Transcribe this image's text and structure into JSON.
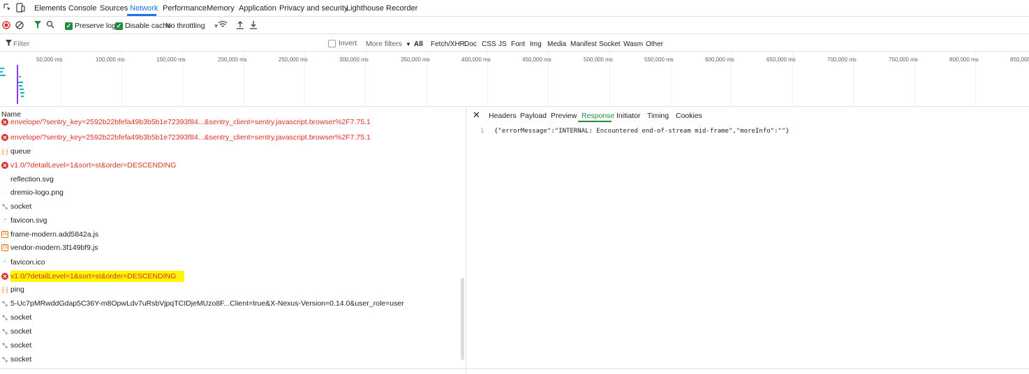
{
  "tabs": {
    "inspect_icon": "inspect-cursor-icon",
    "device_icon": "device-toggle-icon",
    "items": [
      "Elements",
      "Console",
      "Sources",
      "Network",
      "Performance",
      "Memory",
      "Application",
      "Privacy and security",
      "Lighthouse",
      "Recorder"
    ],
    "active": "Network"
  },
  "toolbar": {
    "preserve_log": "Preserve log",
    "disable_cache": "Disable cache",
    "throttling": "No throttling"
  },
  "filter": {
    "placeholder": "Filter",
    "invert": "Invert",
    "more_filters": "More filters",
    "types": [
      "All",
      "Fetch/XHR",
      "Doc",
      "CSS",
      "JS",
      "Font",
      "Img",
      "Media",
      "Manifest",
      "Socket",
      "Wasm",
      "Other"
    ]
  },
  "timeline": {
    "ticks": [
      "50,000 ms",
      "100,000 ms",
      "150,000 ms",
      "200,000 ms",
      "250,000 ms",
      "300,000 ms",
      "350,000 ms",
      "400,000 ms",
      "450,000 ms",
      "500,000 ms",
      "550,000 ms",
      "600,000 ms",
      "650,000 ms",
      "700,000 ms",
      "750,000 ms",
      "800,000 ms",
      "850,000"
    ]
  },
  "list": {
    "header": "Name",
    "requests": [
      {
        "name": "envelope/?sentry_key=2592b22bfefa49b3b5b1e72393f84...&sentry_client=sentry.javascript.browser%2F7.75.1",
        "type": "error"
      },
      {
        "name": "envelope/?sentry_key=2592b22bfefa49b3b5b1e72393f84...&sentry_client=sentry.javascript.browser%2F7.75.1",
        "type": "error"
      },
      {
        "name": "queue",
        "type": "json"
      },
      {
        "name": "v1.0/?detailLevel=1&sort=st&order=DESCENDING",
        "type": "error"
      },
      {
        "name": "reflection.svg",
        "type": "img"
      },
      {
        "name": "dremio-logo.png",
        "type": "img"
      },
      {
        "name": "socket",
        "type": "socket"
      },
      {
        "name": "favicon.svg",
        "type": "favicon"
      },
      {
        "name": "frame-modern.add5842a.js",
        "type": "js"
      },
      {
        "name": "vendor-modern.3f149bf9.js",
        "type": "js"
      },
      {
        "name": "favicon.ico",
        "type": "favicon"
      },
      {
        "name": "v1.0/?detailLevel=1&sort=st&order=DESCENDING",
        "type": "error-highlight"
      },
      {
        "name": "ping",
        "type": "json"
      },
      {
        "name": "5-Uc7pMRwddGdap5C36Y-m8OpwLdv7uRsbVjpqTCIDjeMUzo8F...Client=true&X-Nexus-Version=0.14.0&user_role=user",
        "type": "socket"
      },
      {
        "name": "socket",
        "type": "socket"
      },
      {
        "name": "socket",
        "type": "socket"
      },
      {
        "name": "socket",
        "type": "socket"
      },
      {
        "name": "socket",
        "type": "socket"
      }
    ]
  },
  "detail": {
    "close_icon": "close-icon",
    "tabs": [
      "Headers",
      "Payload",
      "Preview",
      "Response",
      "Initiator",
      "Timing",
      "Cookies"
    ],
    "active": "Response",
    "line_number": "1",
    "response_body": "{\"errorMessage\":\"INTERNAL: Encountered end-of-stream mid-frame\",\"moreInfo\":\"\"}"
  },
  "colors": {
    "accent": "#1a73e8",
    "error": "#d93025",
    "highlight": "#fff700",
    "check_green": "#1e8e3e",
    "active_tab_underline": "#1e8e3e"
  }
}
